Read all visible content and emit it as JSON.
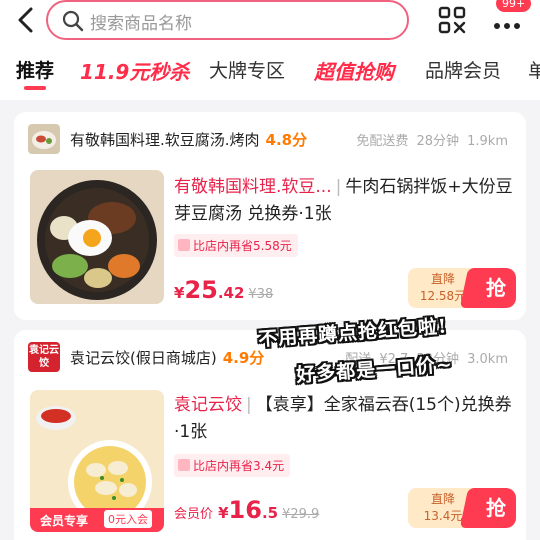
{
  "header": {
    "search_placeholder": "搜索商品名称",
    "badge": "99+"
  },
  "tabs": [
    {
      "label": "推荐",
      "active": true
    },
    {
      "label": "11.9元秒杀"
    },
    {
      "label": "大牌专区"
    },
    {
      "label": "超值抢购"
    },
    {
      "label": "品牌会员"
    },
    {
      "label": "单"
    }
  ],
  "cards": [
    {
      "shop_name": "有敬韩国料理.软豆腐汤.烤肉",
      "rating": "4.8分",
      "delivery": "免配送费 28分钟 1.9km",
      "brand": "有敬韩国料理.软豆...",
      "sep": "|",
      "title": "牛肉石锅拌饭+大份豆芽豆腐汤 兑换券·1张",
      "save": "比店内再省5.58元",
      "price_cur": "¥",
      "price_int": "25",
      "price_dec": ".42",
      "price_orig": "¥38",
      "drop_label": "直降",
      "drop_value": "12.58元",
      "grab": "抢"
    },
    {
      "shop_name": "袁记云饺(假日商城店)",
      "rating": "4.9分",
      "delivery": "配送 ¥2.7 32分钟 3.0km",
      "logo_text": "袁记云饺",
      "brand": "袁记云饺",
      "sep": "|",
      "title": "【袁享】全家福云吞(15个)兑换券·1张",
      "save": "比店内再省3.4元",
      "price_label": "会员价",
      "price_cur": "¥",
      "price_int": "16",
      "price_dec": ".5",
      "price_orig": "¥29.9",
      "drop_label": "直降",
      "drop_value": "13.4元",
      "grab": "抢",
      "member_label": "会员专享",
      "member_join": "0元入会"
    }
  ],
  "overlay": {
    "line1": "不用再蹲点抢红包啦!",
    "line2": "好多都是一口价~"
  },
  "colors": {
    "accent": "#ff3b52",
    "brand_red": "#e8234a",
    "rating_orange": "#ff7a00"
  }
}
